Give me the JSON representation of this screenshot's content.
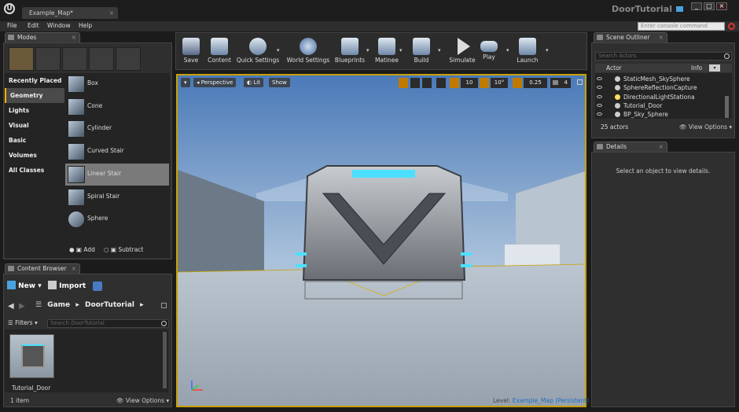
{
  "title_bar": {
    "tab": "Example_Map*",
    "project": "DoorTutorial"
  },
  "menu": [
    "File",
    "Edit",
    "Window",
    "Help"
  ],
  "console_placeholder": "Enter console command",
  "modes_panel": {
    "tab": "Modes",
    "categories": [
      "Recently Placed",
      "Geometry",
      "Lights",
      "Visual",
      "Basic",
      "Volumes",
      "All Classes"
    ],
    "selected_category": "Geometry",
    "items": [
      "Box",
      "Cone",
      "Cylinder",
      "Curved Stair",
      "Linear Stair",
      "Spiral Stair",
      "Sphere"
    ],
    "selected_item": "Linear Stair",
    "add_label": "Add",
    "subtract_label": "Subtract"
  },
  "content_browser": {
    "tab": "Content Browser",
    "new_label": "New",
    "import_label": "Import",
    "path": [
      "Game",
      "DoorTutorial"
    ],
    "filters_label": "Filters",
    "search_placeholder": "Search DoorTutorial",
    "asset_name": "Tutorial_Door",
    "item_count": "1 item",
    "view_options": "View Options"
  },
  "toolbar": [
    "Save",
    "Content",
    "Quick Settings",
    "World Settings",
    "Blueprints",
    "Matinee",
    "Build",
    "Simulate",
    "Play",
    "Launch"
  ],
  "viewport": {
    "perspective_label": "Perspective",
    "lit_label": "Lit",
    "show_label": "Show",
    "grid_snap": "10",
    "rot_snap": "10°",
    "scale_snap": "0.25",
    "camera_speed": "4",
    "level_label": "Level:",
    "level_name": "Example_Map (Persistent)"
  },
  "scene_outliner": {
    "tab": "Scene Outliner",
    "search_placeholder": "Search Actors",
    "col_actor": "Actor",
    "col_info": "Info",
    "actors": [
      "StaticMesh_SkySphere",
      "SphereReflectionCapture",
      "DirectionalLightStationa",
      "Tutorial_Door",
      "BP_Sky_Sphere"
    ],
    "count": "25 actors",
    "view_options": "View Options"
  },
  "details": {
    "tab": "Details",
    "empty_text": "Select an object to view details."
  },
  "colors": {
    "accent": "#ffb000",
    "link": "#4aa3e0",
    "viewport_border": "#c8a000"
  }
}
